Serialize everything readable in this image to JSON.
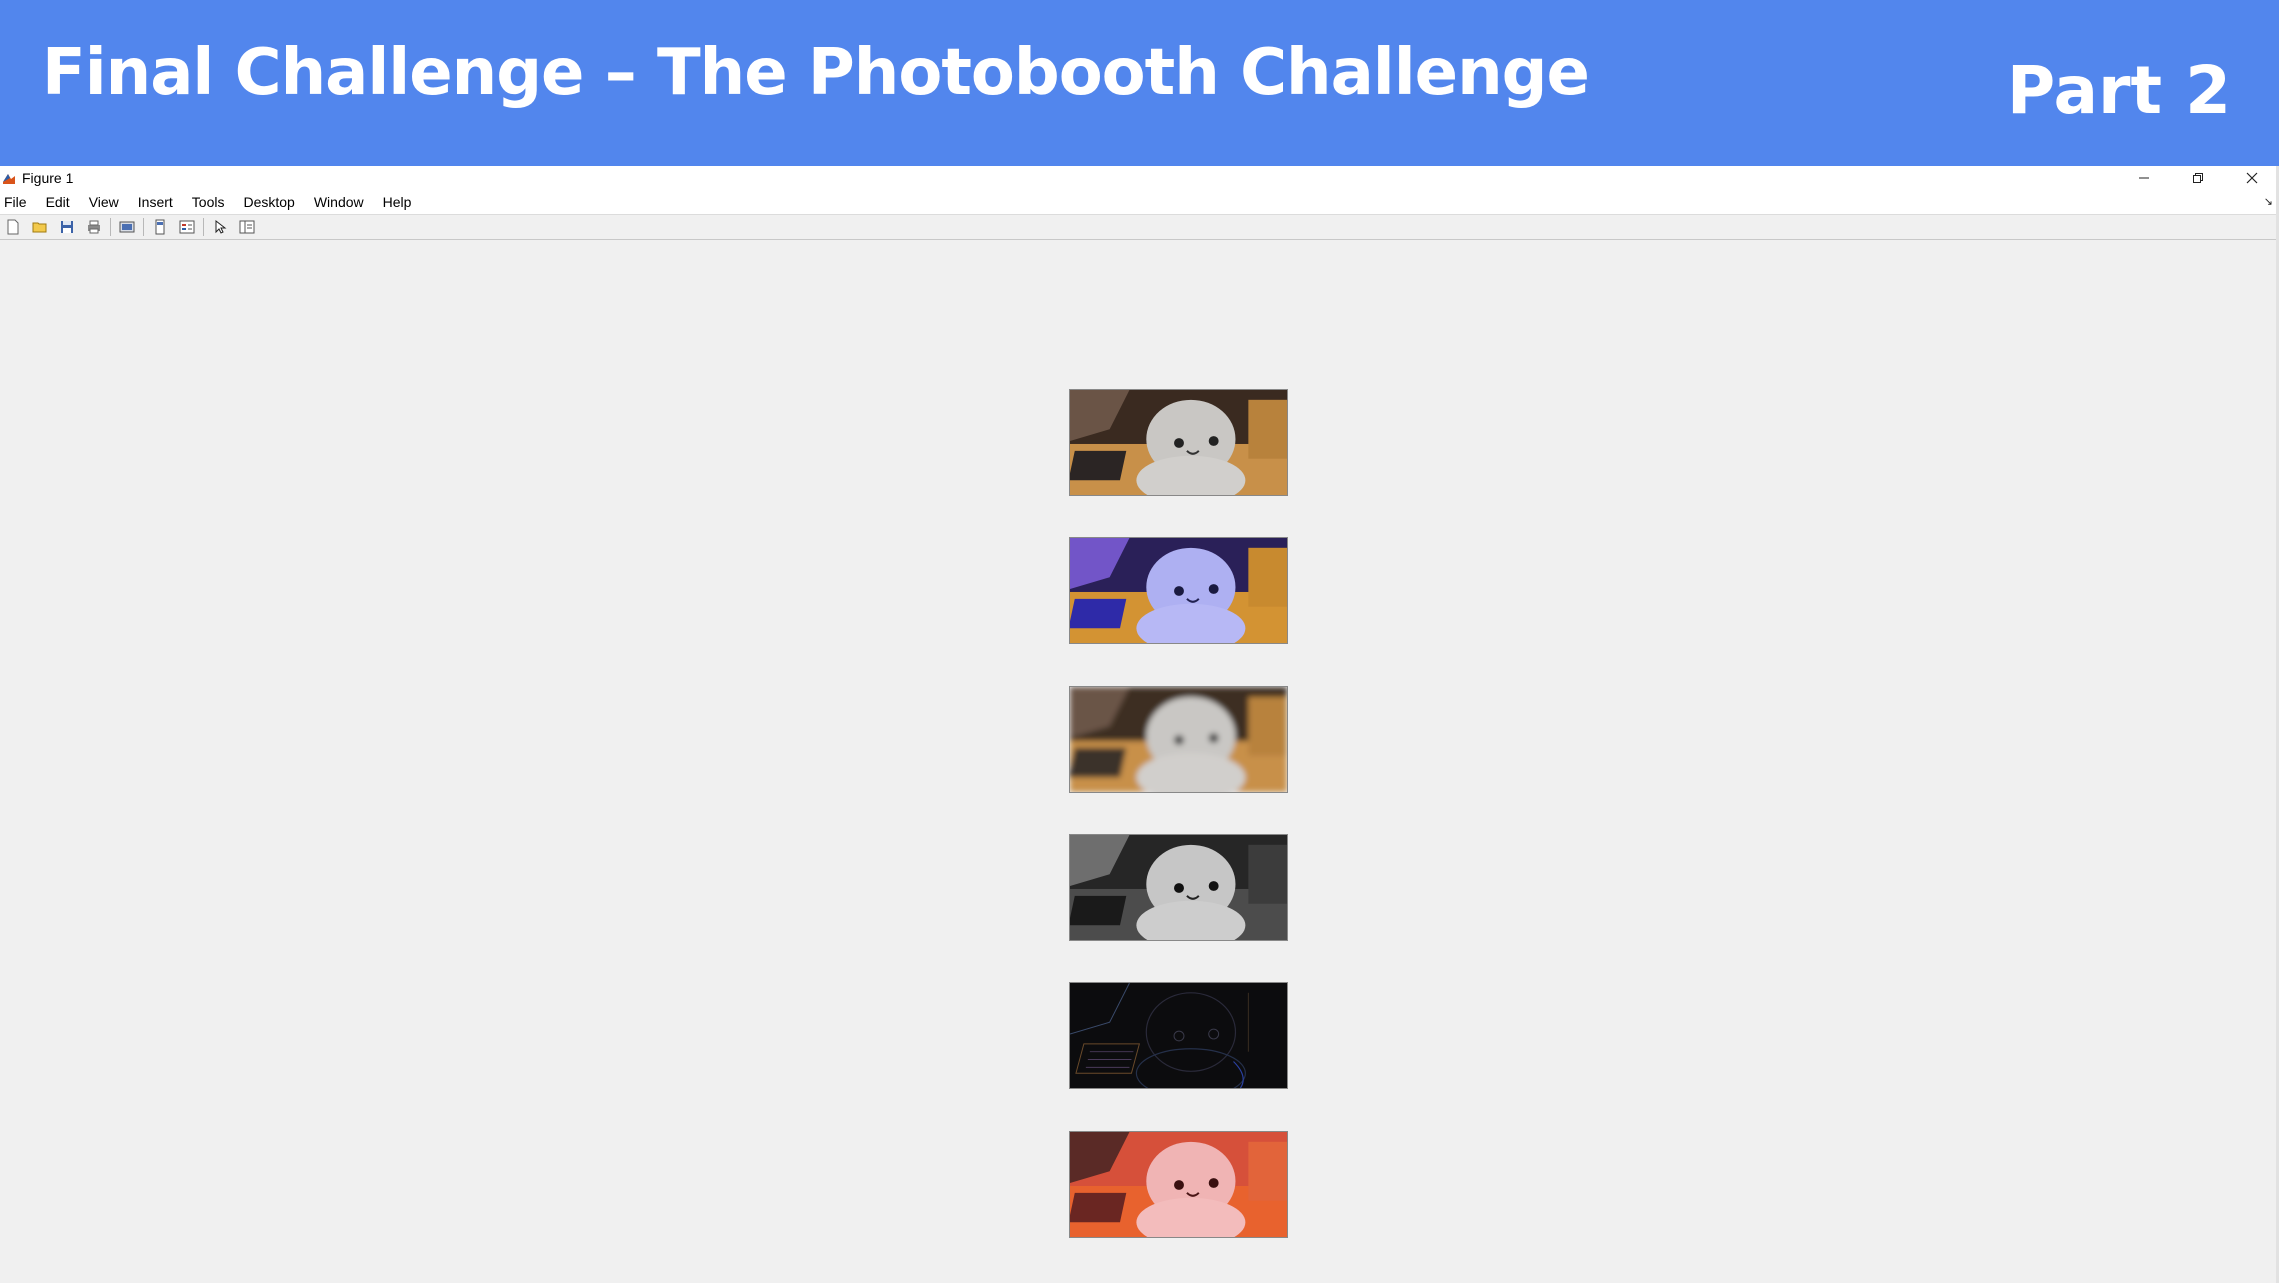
{
  "banner": {
    "title": "Final Challenge – The Photobooth Challenge",
    "part": "Part 2",
    "color": "#5286ed"
  },
  "window": {
    "title": "Figure 1",
    "icon": "matlab-figure-icon",
    "controls": [
      "minimize-icon",
      "restore-icon",
      "close-icon"
    ]
  },
  "menu": {
    "items": [
      "File",
      "Edit",
      "View",
      "Insert",
      "Tools",
      "Desktop",
      "Window",
      "Help"
    ]
  },
  "toolbar": {
    "buttons": [
      "new-figure-icon",
      "open-file-icon",
      "save-icon",
      "print-icon",
      "print-preview-icon",
      "link-plot-icon",
      "insert-legend-icon",
      "edit-plot-icon",
      "property-inspector-icon"
    ]
  },
  "figure": {
    "images": [
      {
        "filter": "original"
      },
      {
        "filter": "blue-tint"
      },
      {
        "filter": "blur"
      },
      {
        "filter": "grayscale"
      },
      {
        "filter": "edge-detect"
      },
      {
        "filter": "red-tint"
      }
    ]
  }
}
